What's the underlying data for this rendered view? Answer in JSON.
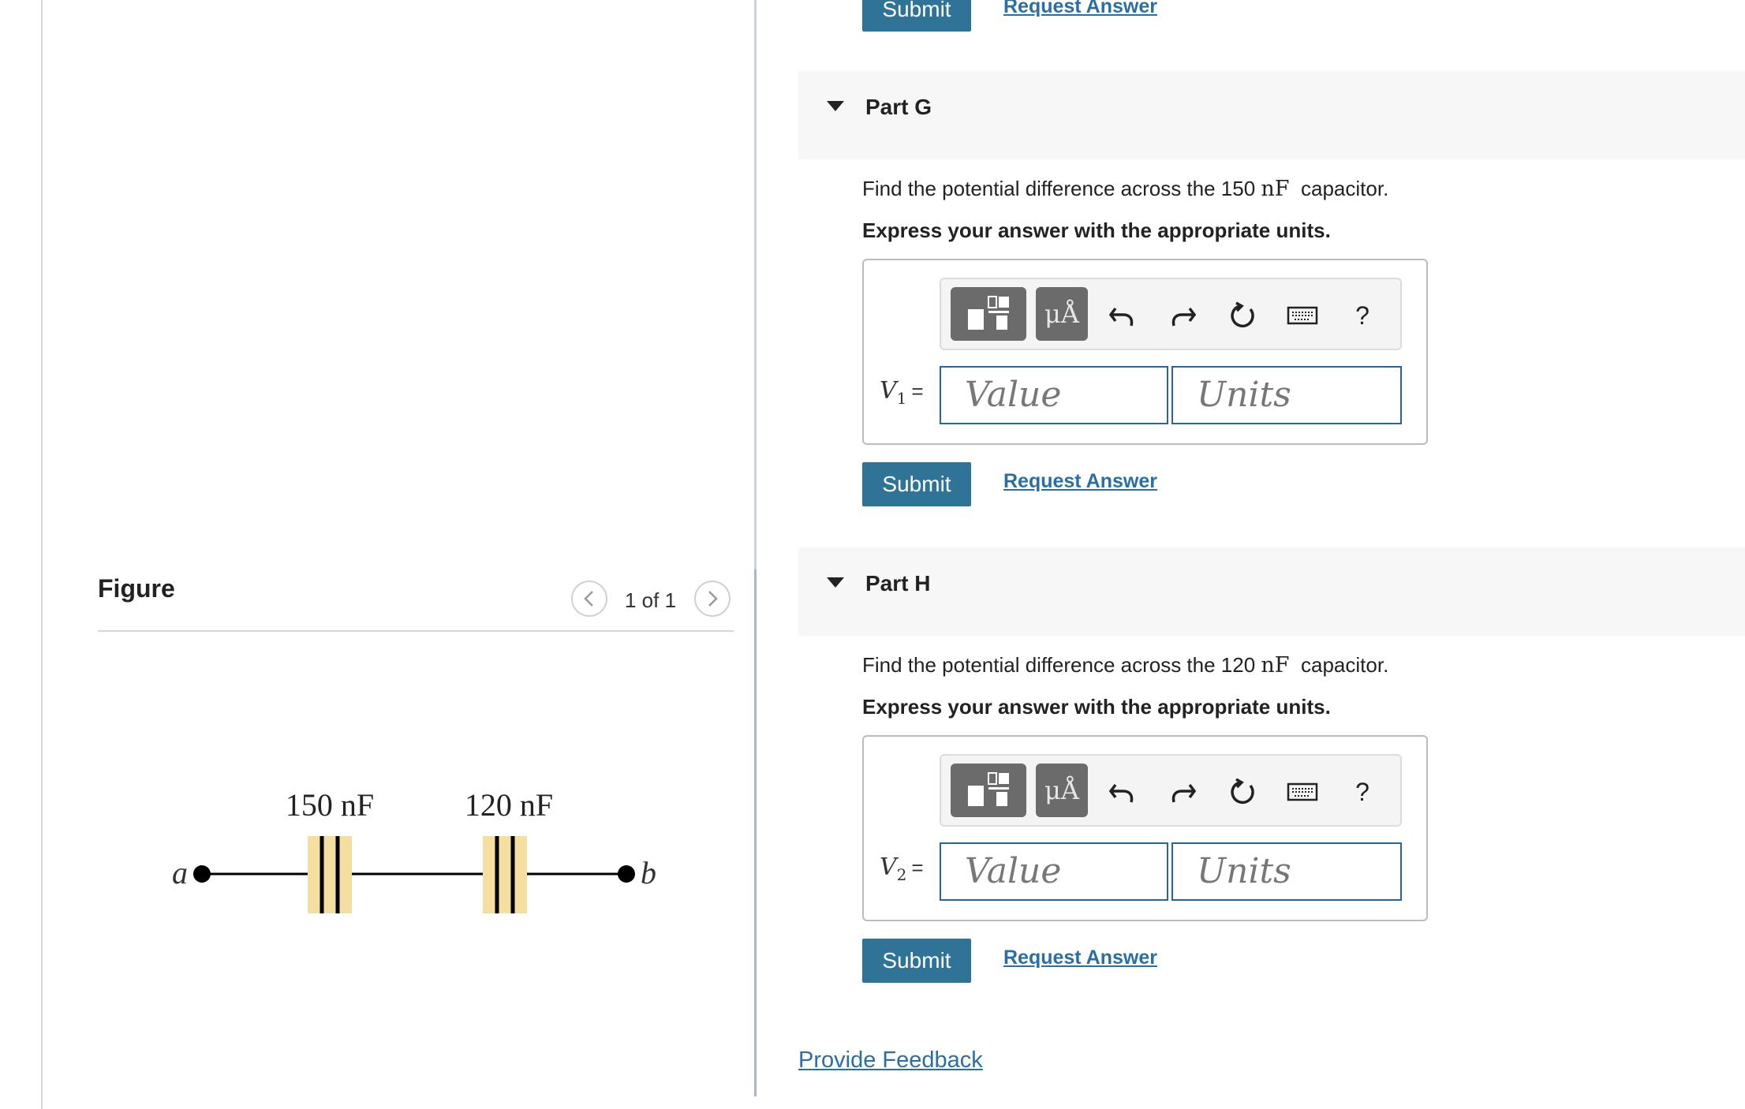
{
  "figure": {
    "title": "Figure",
    "counter": "1 of 1",
    "circuit": {
      "left_terminal": "a",
      "right_terminal": "b",
      "capacitors": [
        {
          "label": "150 nF"
        },
        {
          "label": "120 nF"
        }
      ],
      "plate_highlight_color": "#f5dfa0"
    }
  },
  "top_actions": {
    "submit_label": "Submit",
    "request_label": "Request Answer"
  },
  "parts": [
    {
      "title": "Part G",
      "question_prefix": "Find the potential difference across the 150",
      "question_unit": "nF",
      "question_suffix": "capacitor.",
      "instruction": "Express your answer with the appropriate units.",
      "variable": "V",
      "variable_sub": "1",
      "equals": "=",
      "value_placeholder": "Value",
      "units_placeholder": "Units",
      "toolbar": {
        "units_button": "μÅ",
        "help": "?"
      },
      "submit_label": "Submit",
      "request_label": "Request Answer"
    },
    {
      "title": "Part H",
      "question_prefix": "Find the potential difference across the 120",
      "question_unit": "nF",
      "question_suffix": "capacitor.",
      "instruction": "Express your answer with the appropriate units.",
      "variable": "V",
      "variable_sub": "2",
      "equals": "=",
      "value_placeholder": "Value",
      "units_placeholder": "Units",
      "toolbar": {
        "units_button": "μÅ",
        "help": "?"
      },
      "submit_label": "Submit",
      "request_label": "Request Answer"
    }
  ],
  "feedback_label": "Provide Feedback",
  "colors": {
    "accent": "#2f7396",
    "link": "#2a6fa3",
    "field_border": "#2a6496"
  }
}
